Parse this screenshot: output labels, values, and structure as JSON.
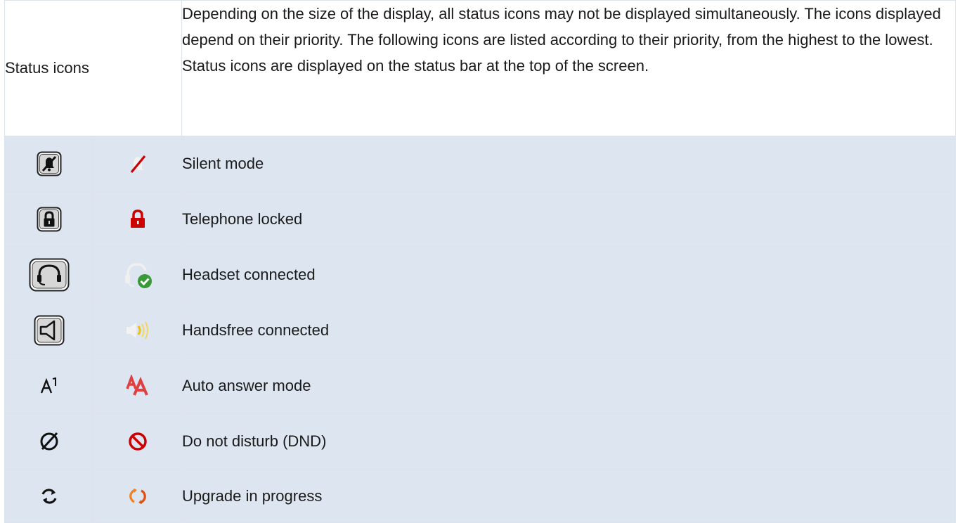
{
  "heading": "Status icons",
  "description": [
    "Depending on the size of the display, all status icons may not be displayed simultaneously. The icons displayed depend on their priority. The following icons are listed according to their priority, from the highest to the lowest.",
    "Status icons are displayed on the status bar at the top of the screen."
  ],
  "rows": [
    {
      "label": "Silent mode",
      "icon_mono": "silent-mode-icon",
      "icon_color": "silent-mode-red-icon"
    },
    {
      "label": "Telephone locked",
      "icon_mono": "lock-icon",
      "icon_color": "lock-red-icon"
    },
    {
      "label": "Headset connected",
      "icon_mono": "headset-icon",
      "icon_color": "headset-connected-icon"
    },
    {
      "label": "Handsfree connected",
      "icon_mono": "speaker-icon",
      "icon_color": "speaker-yellow-icon"
    },
    {
      "label": "Auto answer mode",
      "icon_mono": "auto-answer-icon",
      "icon_color": "auto-answer-red-icon"
    },
    {
      "label": "Do not disturb (DND)",
      "icon_mono": "dnd-icon",
      "icon_color": "dnd-red-icon"
    },
    {
      "label": "Upgrade in progress",
      "icon_mono": "upgrade-icon",
      "icon_color": "upgrade-orange-icon"
    }
  ],
  "colors": {
    "row_background": "#dce5f0",
    "border": "#dde3ea",
    "accent_red": "#cc0000",
    "accent_green": "#3a9a3a",
    "accent_yellow": "#f2c200",
    "accent_orange": "#f08020"
  }
}
